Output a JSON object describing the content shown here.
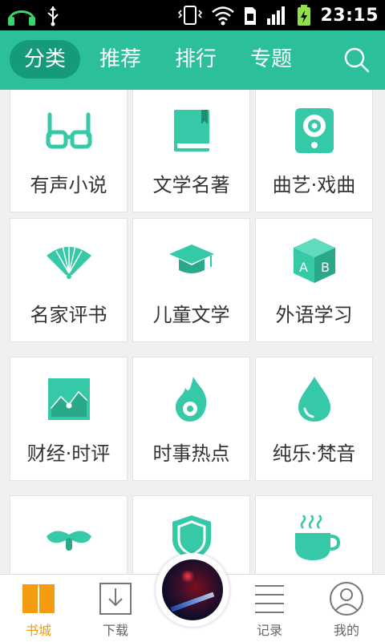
{
  "statusbar": {
    "time": "23:15",
    "icons": [
      "headset-icon",
      "usb-icon",
      "vibrate-icon",
      "wifi-icon",
      "sim-icon",
      "signal-icon",
      "battery-charging-icon"
    ]
  },
  "header": {
    "tabs": [
      {
        "label": "分类",
        "active": true
      },
      {
        "label": "推荐",
        "active": false
      },
      {
        "label": "排行",
        "active": false
      },
      {
        "label": "专题",
        "active": false
      }
    ],
    "search_icon": "search-icon"
  },
  "categories": [
    {
      "label": "有声小说",
      "icon": "glasses-icon"
    },
    {
      "label": "文学名著",
      "icon": "book-icon"
    },
    {
      "label": "曲艺·戏曲",
      "icon": "speaker-icon"
    },
    {
      "label": "名家评书",
      "icon": "fan-icon"
    },
    {
      "label": "儿童文学",
      "icon": "graduation-cap-icon"
    },
    {
      "label": "外语学习",
      "icon": "letter-cube-icon"
    },
    {
      "label": "财经·时评",
      "icon": "line-chart-icon"
    },
    {
      "label": "时事热点",
      "icon": "flame-icon"
    },
    {
      "label": "纯乐·梵音",
      "icon": "droplet-icon"
    },
    {
      "label": "",
      "icon": "mustache-icon"
    },
    {
      "label": "",
      "icon": "shield-icon"
    },
    {
      "label": "",
      "icon": "coffee-cup-icon"
    }
  ],
  "bottom_nav": {
    "items": [
      {
        "label": "书城",
        "icon": "bookstore-icon",
        "active": true
      },
      {
        "label": "下载",
        "icon": "download-icon",
        "active": false
      },
      {
        "label": "记录",
        "icon": "list-icon",
        "active": false
      },
      {
        "label": "我的",
        "icon": "profile-icon",
        "active": false
      }
    ],
    "player_icon": "now-playing-disc"
  },
  "colors": {
    "accent": "#2bbf9b",
    "accent_dark": "#159b79",
    "icon_teal": "#35c9a7",
    "nav_active": "#f39c12"
  }
}
